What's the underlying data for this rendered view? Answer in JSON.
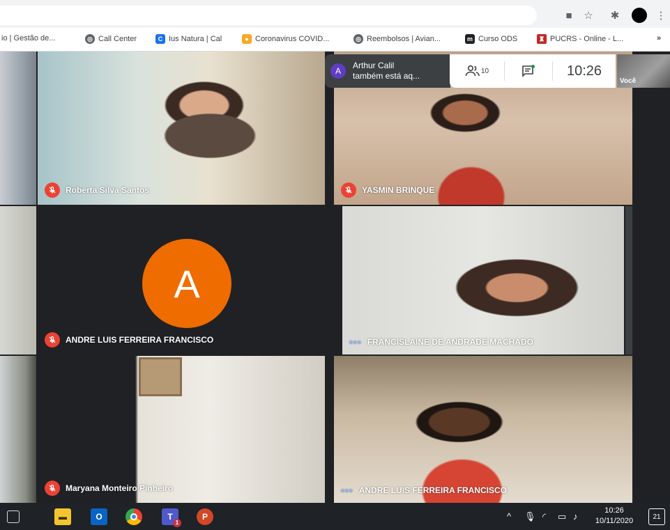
{
  "browser": {
    "bookmarks": [
      {
        "label": "io | Gestão de...",
        "icon": "none"
      },
      {
        "label": "Call Center",
        "icon": "globe-icon"
      },
      {
        "label": "Ius Natura | Cal",
        "icon": "c-icon"
      },
      {
        "label": "Coronavirus COVID...",
        "icon": "covid-icon"
      },
      {
        "label": "Reembolsos | Avian...",
        "icon": "globe-icon"
      },
      {
        "label": "Curso ODS",
        "icon": "m-icon"
      },
      {
        "label": "PUCRS - Online - L...",
        "icon": "pucrs-icon"
      }
    ],
    "bookmarks_more": "»"
  },
  "meet": {
    "notification": {
      "avatar_letter": "A",
      "name": "Arthur Calil",
      "message": "também está aq..."
    },
    "participants_count": "10",
    "clock": "10:26",
    "self_label": "Você",
    "tiles": [
      {
        "name": "Roberta Silva Santos",
        "status": "muted"
      },
      {
        "name": "YASMIN BRINQUE",
        "status": "muted"
      },
      {
        "name": "ANDRE LUIS FERREIRA FRANCISCO",
        "status": "muted",
        "avatar_letter": "A"
      },
      {
        "name": "FRANCISLAINE DE ANDRADE MACHADO",
        "status": "speaking"
      },
      {
        "name": "Maryana Monteiro Pinheiro",
        "status": "muted"
      },
      {
        "name": "ANDRE LUIS FERREIRA FRANCISCO",
        "status": "speaking"
      }
    ]
  },
  "taskbar": {
    "apps": [
      "task-view-icon",
      "file-explorer-icon",
      "outlook-icon",
      "chrome-icon",
      "teams-icon",
      "powerpoint-icon"
    ],
    "teams_badge": "1",
    "time": "10:26",
    "date": "10/11/2020",
    "notification_count": "21"
  },
  "colors": {
    "meet_bg": "#202124",
    "mute_red": "#ea4335",
    "avatar_orange": "#ef6c00",
    "speaking_blue": "#8ab4f8"
  }
}
